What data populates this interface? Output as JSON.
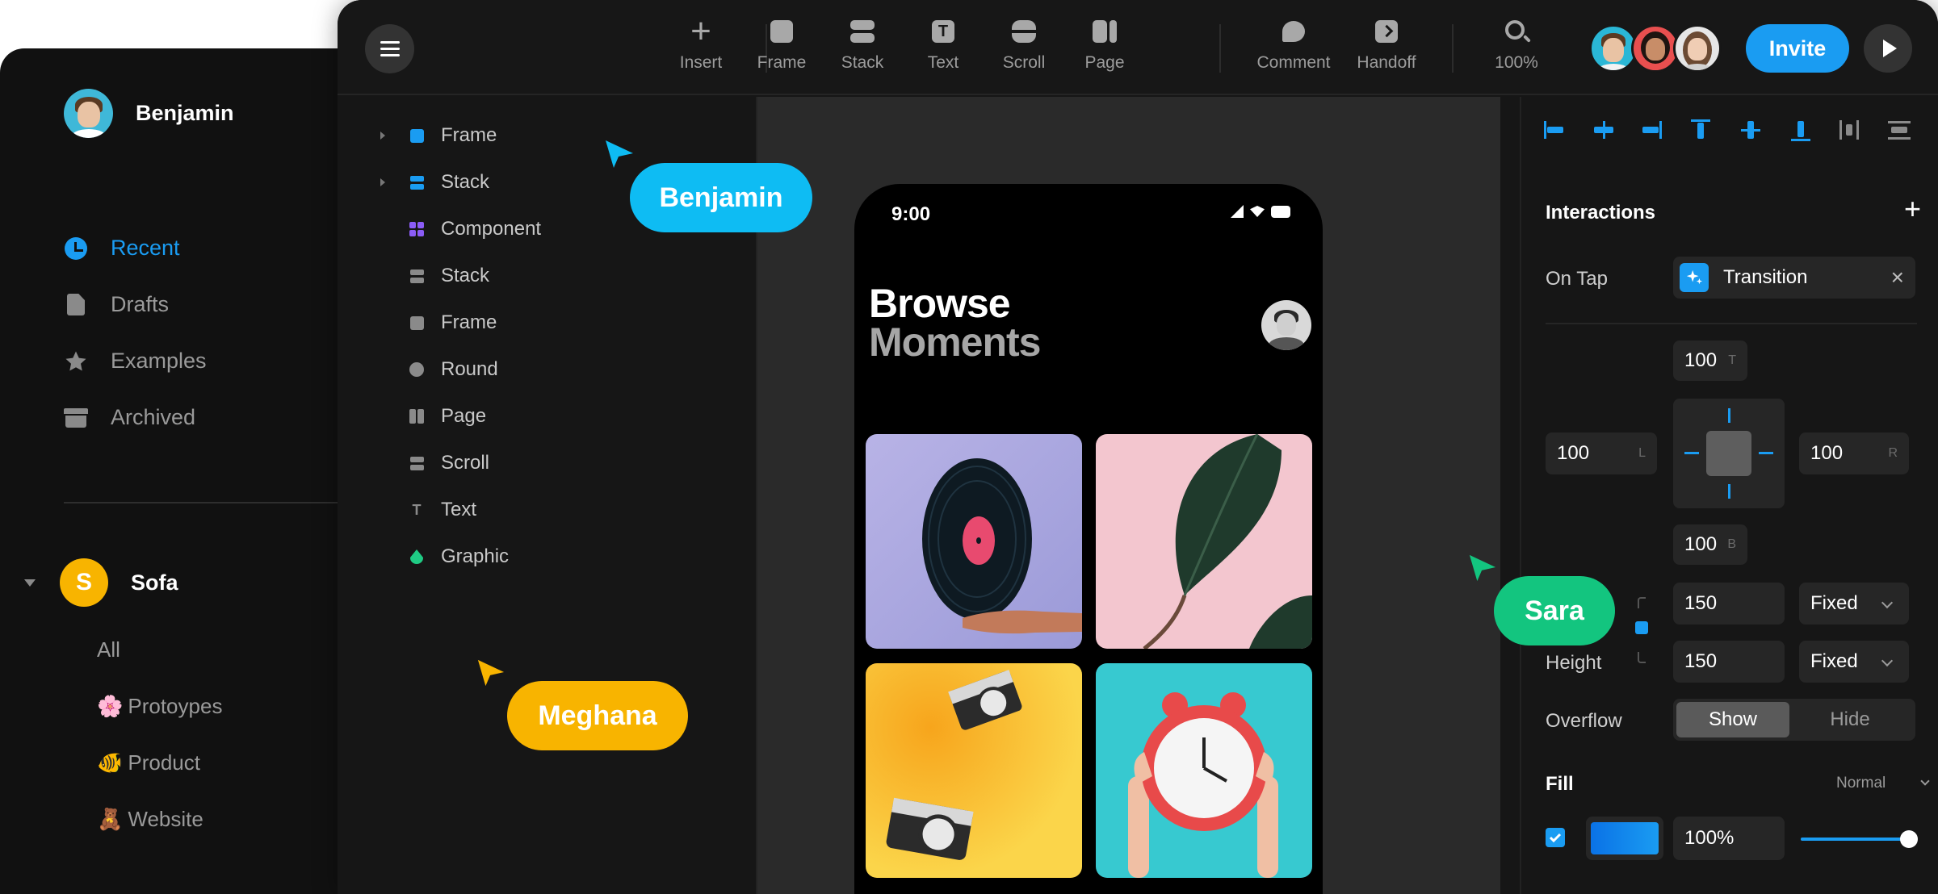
{
  "dashboard": {
    "user_name": "Benjamin",
    "nav": [
      {
        "label": "Recent",
        "icon": "clock-icon",
        "active": true
      },
      {
        "label": "Drafts",
        "icon": "document-icon",
        "active": false
      },
      {
        "label": "Examples",
        "icon": "star-icon",
        "active": false
      },
      {
        "label": "Archived",
        "icon": "archive-icon",
        "active": false
      }
    ],
    "team": {
      "initial": "S",
      "name": "Sofa"
    },
    "projects": [
      {
        "emoji": "",
        "label": "All"
      },
      {
        "emoji": "🌸",
        "label": "Protoypes"
      },
      {
        "emoji": "🐠",
        "label": "Product"
      },
      {
        "emoji": "🧸",
        "label": "Website"
      }
    ]
  },
  "toolbar": {
    "tools": [
      {
        "label": "Insert",
        "icon": "plus-icon"
      },
      {
        "label": "Frame",
        "icon": "frame-icon"
      },
      {
        "label": "Stack",
        "icon": "stack-icon"
      },
      {
        "label": "Text",
        "icon": "text-icon"
      },
      {
        "label": "Scroll",
        "icon": "scroll-icon"
      },
      {
        "label": "Page",
        "icon": "page-icon"
      },
      {
        "label": "Comment",
        "icon": "comment-icon"
      },
      {
        "label": "Handoff",
        "icon": "handoff-icon"
      },
      {
        "label": "100%",
        "icon": "search-icon"
      }
    ],
    "invite_label": "Invite"
  },
  "layers": [
    {
      "label": "Frame",
      "icon": "frame-icon",
      "color": "#1a9cf2",
      "expandable": true
    },
    {
      "label": "Stack",
      "icon": "stack-icon",
      "color": "#1a9cf2",
      "expandable": true
    },
    {
      "label": "Component",
      "icon": "component-icon",
      "color": "#8b5cf6",
      "expandable": false
    },
    {
      "label": "Stack",
      "icon": "stack-icon",
      "color": "#8a8a8a",
      "expandable": false
    },
    {
      "label": "Frame",
      "icon": "frame-icon",
      "color": "#8a8a8a",
      "expandable": false
    },
    {
      "label": "Round",
      "icon": "circle-icon",
      "color": "#8a8a8a",
      "expandable": false
    },
    {
      "label": "Page",
      "icon": "page-icon",
      "color": "#8a8a8a",
      "expandable": false
    },
    {
      "label": "Scroll",
      "icon": "scroll-icon",
      "color": "#8a8a8a",
      "expandable": false
    },
    {
      "label": "Text",
      "icon": "text-icon",
      "color": "#8a8a8a",
      "expandable": false
    },
    {
      "label": "Graphic",
      "icon": "graphic-icon",
      "color": "#1fcb84",
      "expandable": false
    }
  ],
  "phone": {
    "time": "9:00",
    "title_line1": "Browse",
    "title_line2": "Moments",
    "text_glyph": "T"
  },
  "cursors": [
    {
      "name": "Benjamin",
      "color": "#0ebcf3"
    },
    {
      "name": "Meghana",
      "color": "#f8b400"
    },
    {
      "name": "Sara",
      "color": "#13c57f"
    }
  ],
  "properties": {
    "interactions_title": "Interactions",
    "add_symbol": "+",
    "on_tap_label": "On Tap",
    "transition_label": "Transition",
    "remove_symbol": "×",
    "position": {
      "top": "100",
      "top_suffix": "T",
      "left": "100",
      "left_suffix": "L",
      "right": "100",
      "right_suffix": "R",
      "bottom": "100",
      "bottom_suffix": "B"
    },
    "width_value": "150",
    "width_mode": "Fixed",
    "height_label": "Height",
    "height_value": "150",
    "height_mode": "Fixed",
    "overflow_label": "Overflow",
    "overflow_options": [
      "Show",
      "Hide"
    ],
    "overflow_selected": "Show",
    "fill_title": "Fill",
    "fill_blend": "Normal",
    "fill_opacity": "100%",
    "fill_opacity_value": 1.0,
    "fill_checked": true,
    "accent_color": "#1a9cf2"
  }
}
